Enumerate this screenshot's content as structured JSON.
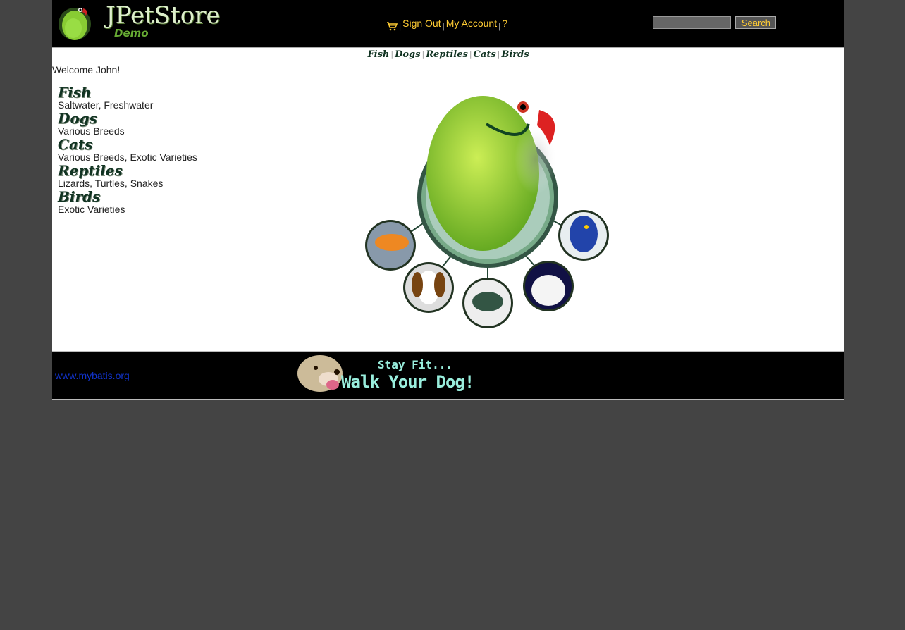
{
  "header": {
    "logo_title": "JPetStore",
    "logo_subtitle": "Demo",
    "menu": {
      "cart_icon": "shopping-cart-icon",
      "sign_out": "Sign Out",
      "my_account": "My Account",
      "help": "?",
      "separator": "|"
    },
    "search": {
      "value": "",
      "button_label": "Search"
    }
  },
  "quicklinks": {
    "items": [
      "Fish",
      "Dogs",
      "Reptiles",
      "Cats",
      "Birds"
    ],
    "separator": "|"
  },
  "welcome": "Welcome John!",
  "sidebar": {
    "categories": [
      {
        "title": "Fish",
        "description": "Saltwater, Freshwater"
      },
      {
        "title": "Dogs",
        "description": "Various Breeds"
      },
      {
        "title": "Cats",
        "description": "Various Breeds, Exotic Varieties"
      },
      {
        "title": "Reptiles",
        "description": "Lizards, Turtles, Snakes"
      },
      {
        "title": "Birds",
        "description": "Exotic Varieties"
      }
    ]
  },
  "main_image": {
    "icon": "pet-collage-image"
  },
  "footer": {
    "powered_by": "www.mybatis.org",
    "banner_line1": "Stay Fit...",
    "banner_line2": "Walk Your Dog!"
  },
  "colors": {
    "page_background": "#444444",
    "header_background": "#000000",
    "menu_link": "#ffcc33",
    "footer_link": "#1133cc"
  }
}
